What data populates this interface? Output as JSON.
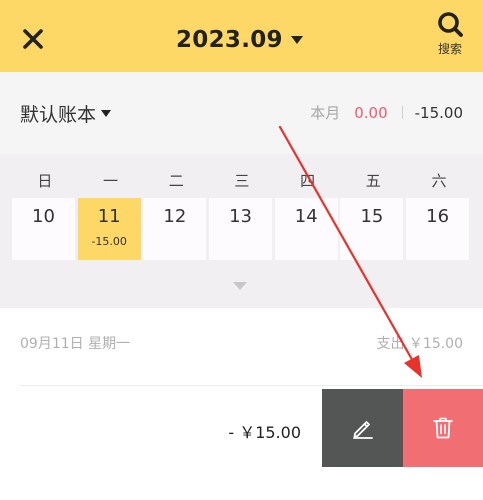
{
  "header": {
    "close_icon": "close-icon",
    "title": "2023.09",
    "search_label": "搜索",
    "colors": {
      "background": "#fdd866"
    }
  },
  "book_bar": {
    "book_name": "默认账本",
    "month_label": "本月",
    "income": "0.00",
    "expense": "-15.00",
    "colors": {
      "income": "#f15b6c"
    }
  },
  "calendar": {
    "weekdays": [
      "日",
      "一",
      "二",
      "三",
      "四",
      "五",
      "六"
    ],
    "days": [
      {
        "num": "10",
        "amount": ""
      },
      {
        "num": "11",
        "amount": "-15.00",
        "selected": true
      },
      {
        "num": "12",
        "amount": ""
      },
      {
        "num": "13",
        "amount": ""
      },
      {
        "num": "14",
        "amount": ""
      },
      {
        "num": "15",
        "amount": ""
      },
      {
        "num": "16",
        "amount": ""
      }
    ],
    "colors": {
      "selected": "#fdd866"
    }
  },
  "day_summary": {
    "date": "09月11日 星期一",
    "total": "支出  ￥15.00"
  },
  "record": {
    "amount": "- ￥15.00",
    "actions": {
      "edit_icon": "pencil-icon",
      "delete_icon": "trash-icon"
    },
    "colors": {
      "edit": "#545555",
      "delete": "#f16e73"
    }
  },
  "annotation": {
    "color": "#e8322c"
  }
}
